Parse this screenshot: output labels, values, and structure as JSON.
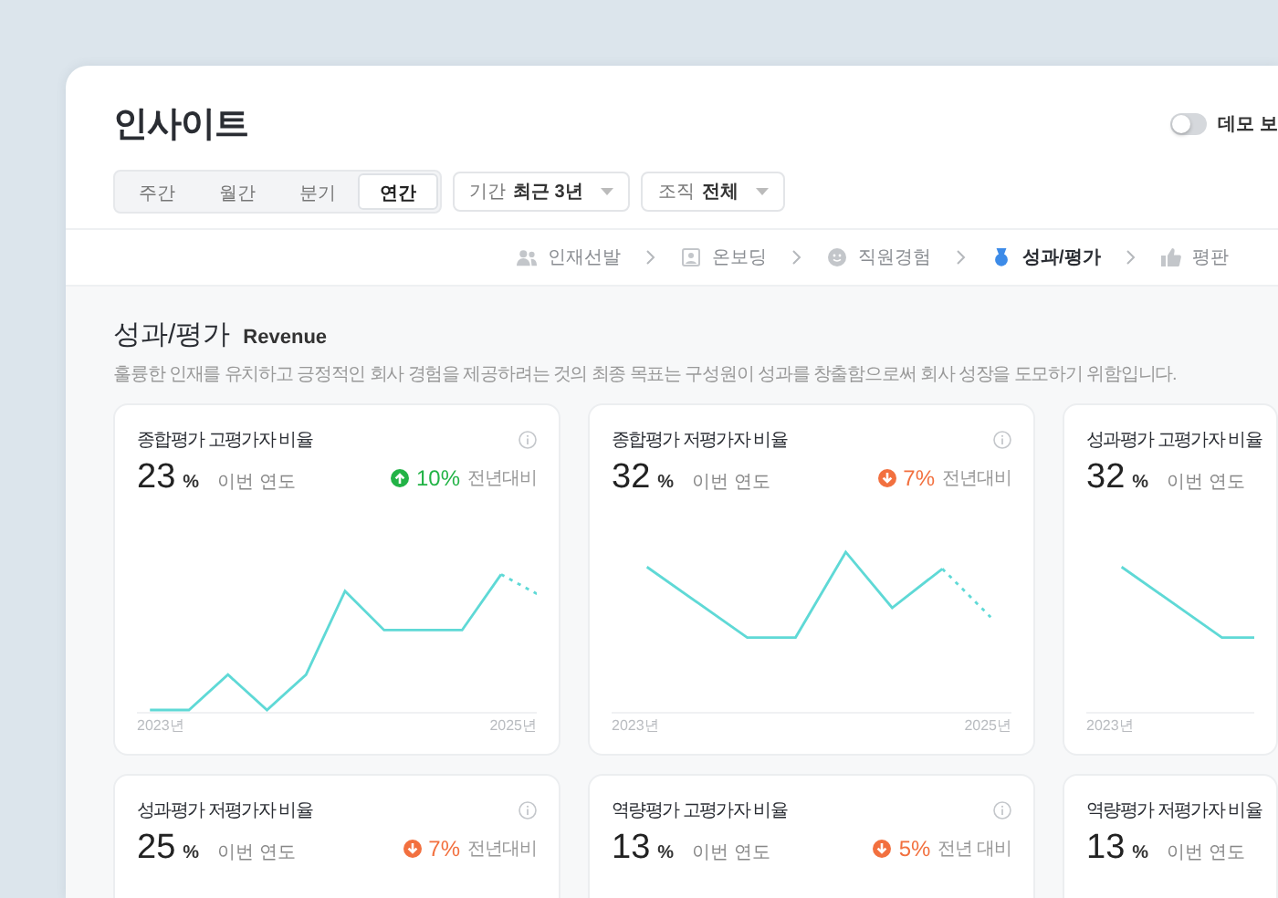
{
  "header": {
    "title": "인사이트",
    "demo_toggle": {
      "label": "데모 보",
      "on": false
    }
  },
  "period_tabs": [
    {
      "label": "주간",
      "selected": false
    },
    {
      "label": "월간",
      "selected": false
    },
    {
      "label": "분기",
      "selected": false
    },
    {
      "label": "연간",
      "selected": true
    }
  ],
  "filters": [
    {
      "label": "기간",
      "value": "최근 3년"
    },
    {
      "label": "조직",
      "value": "전체"
    }
  ],
  "steps": [
    {
      "label": "인재선발",
      "selected": false
    },
    {
      "label": "온보딩",
      "selected": false
    },
    {
      "label": "직원경험",
      "selected": false
    },
    {
      "label": "성과/평가",
      "selected": true
    },
    {
      "label": "평판",
      "selected": false
    }
  ],
  "section": {
    "title": "성과/평가",
    "subtitle": "Revenue",
    "description": "훌륭한 인재를 유치하고 긍정적인 회사 경험을 제공하려는 것의 최종 목표는 구성원이 성과를 창출함으로써 회사 성장을 도모하기 위함입니다."
  },
  "cards": [
    {
      "title": "종합평가 고평가자 비율",
      "value": "23",
      "unit": "%",
      "period": "이번 연도",
      "info": true,
      "delta": {
        "kind": "up",
        "value": "10%",
        "label": "전년대비"
      },
      "chart": {
        "x_labels": [
          "2023년",
          "2025년"
        ]
      }
    },
    {
      "title": "종합평가 저평가자 비율",
      "value": "32",
      "unit": "%",
      "period": "이번 연도",
      "info": true,
      "delta": {
        "kind": "down",
        "value": "7%",
        "label": "전년대비"
      },
      "chart": {
        "x_labels": [
          "2023년",
          "2025년"
        ]
      }
    },
    {
      "title": "성과평가 고평가자 비율",
      "value": "32",
      "unit": "%",
      "period": "이번 연도",
      "info": false,
      "chart": {
        "x_labels": [
          "2023년"
        ]
      }
    },
    {
      "title": "성과평가 저평가자 비율",
      "value": "25",
      "unit": "%",
      "period": "이번 연도",
      "info": true,
      "delta": {
        "kind": "down",
        "value": "7%",
        "label": "전년대비"
      }
    },
    {
      "title": "역량평가 고평가자 비율",
      "value": "13",
      "unit": "%",
      "period": "이번 연도",
      "info": true,
      "delta": {
        "kind": "down",
        "value": "5%",
        "label": "전년 대비"
      }
    },
    {
      "title": "역량평가 저평가자 비율",
      "value": "13",
      "unit": "%",
      "period": "이번 연도",
      "info": false
    }
  ]
}
